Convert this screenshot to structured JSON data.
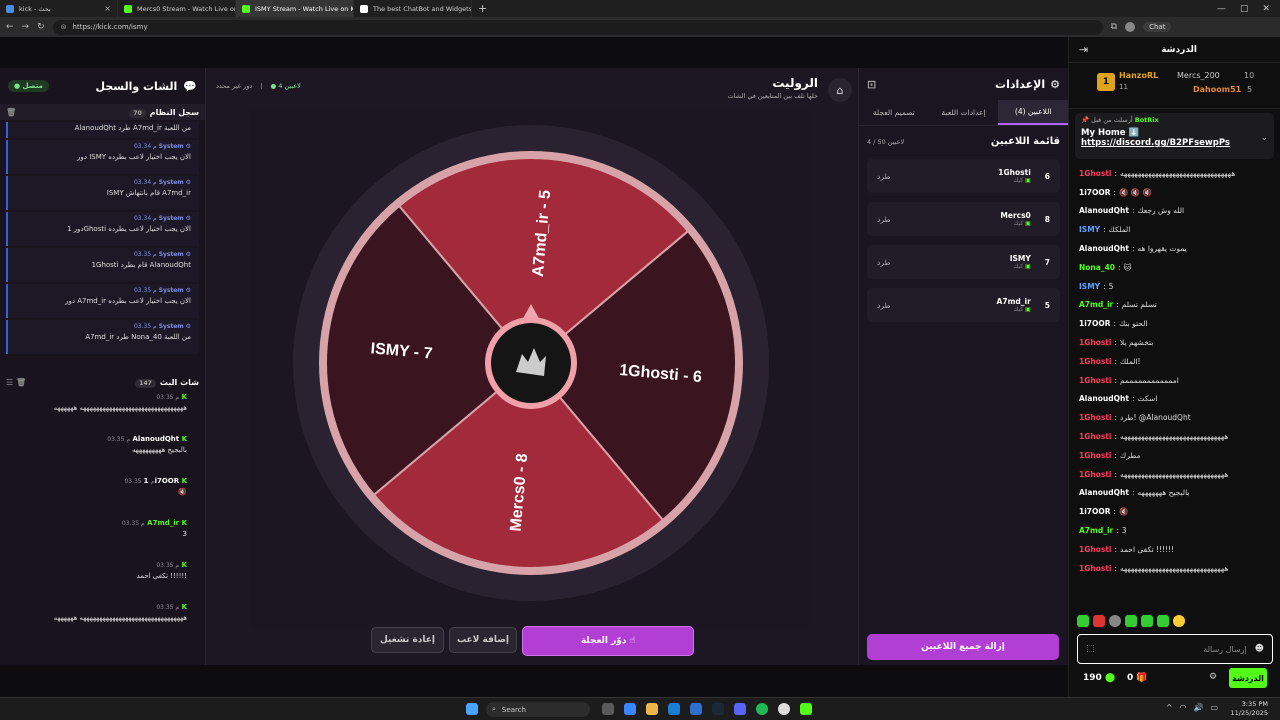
{
  "browser": {
    "tabs": [
      {
        "title": "kick - بحث",
        "color": "#4a90e2"
      },
      {
        "title": "Mercs0 Stream - Watch Live on Kick",
        "color": "#53fc18"
      },
      {
        "title": "ISMY Stream - Watch Live on Kick",
        "color": "#53fc18"
      },
      {
        "title": "The best ChatBot and Widgets fo...",
        "color": "#ffffff"
      }
    ],
    "new_tab": "+",
    "url": "https://kick.com/ismy",
    "profile": "Chat"
  },
  "left_panel": {
    "title": "الشات والسجل",
    "status": "متصل",
    "system_log": {
      "title": "سجل النظام",
      "count": "70",
      "top_text": "AlanoudQht طرد A7md_ir من اللعبة",
      "entries": [
        {
          "sender": "System",
          "time": "03.34 م",
          "text": "دور ISMY الان يجب اختيار لاعب بطرده"
        },
        {
          "sender": "System",
          "time": "03.34 م",
          "text": "ISMY قام بانتهاش A7md_ir"
        },
        {
          "sender": "System",
          "time": "03.34 م",
          "text": "دور 1Ghosti الان يجب اختيار لاعب يطرده"
        },
        {
          "sender": "System",
          "time": "03.35 م",
          "text": "1Ghosti قام بطرد AlanoudQht"
        },
        {
          "sender": "System",
          "time": "03.35 م",
          "text": "دور A7md_ir الان يجب اختيار لاعب بطرده"
        },
        {
          "sender": "System",
          "time": "03.35 م",
          "text": "A7md_ir طرد Nona_40 من اللعبة"
        }
      ]
    },
    "stream_chat": {
      "title": "شات البث",
      "count": "147",
      "messages": [
        {
          "user": "",
          "time": "03.35 م",
          "color": "#ff3b5c",
          "text": "ههههههههههههههههههههههههههههههههه ههههههه"
        },
        {
          "user": "AlanoudQht",
          "time": "03.35 م",
          "color": "#ffffff",
          "text": "بالبجيح هههههههههه"
        },
        {
          "user": "1i7OOR",
          "time": "03.35 م",
          "color": "#ffffff",
          "text": "🔇"
        },
        {
          "user": "A7md_ir",
          "time": "03.35 م",
          "color": "#53fc18",
          "text": "3"
        },
        {
          "user": "",
          "time": "03.35 م",
          "color": "#ff3b5c",
          "text": "تكفى احمد !!!!!!"
        },
        {
          "user": "",
          "time": "03.35 م",
          "color": "#ff3b5c",
          "text": "ههههههههههههههههههههههههههههههههه ههههههه"
        }
      ]
    }
  },
  "game": {
    "title": "الروليت",
    "subtitle": "خلها تلف بين المتابعين في الشات",
    "players_count": "4 لاعبين",
    "turn": "دور غير محدد",
    "segments": [
      {
        "label": "A7md_ir - 5",
        "color": "#a22a3a"
      },
      {
        "label": "1Ghosti - 6",
        "color": "#3a1520"
      },
      {
        "label": "Mercs0 - 8",
        "color": "#a22a3a"
      },
      {
        "label": "ISMY - 7",
        "color": "#3a1520"
      }
    ],
    "spin_button": "دوّر العجلة",
    "add_button": "إضافة لاعب",
    "restart_button": "إعادة تشغيل"
  },
  "settings": {
    "title": "الإعدادات",
    "tabs": [
      "اللاعبين (4)",
      "إعدادات اللعبة",
      "تصميم العجلة"
    ],
    "list_title": "قائمة اللاعبين",
    "list_count": "4 / 50 لاعبين",
    "players": [
      {
        "num": "6",
        "name": "1Ghosti",
        "tag": "كيك",
        "action": "طرد"
      },
      {
        "num": "8",
        "name": "Mercs0",
        "tag": "كيك",
        "action": "طرد"
      },
      {
        "num": "7",
        "name": "ISMY",
        "tag": "كيك",
        "action": "طرد"
      },
      {
        "num": "5",
        "name": "A7md_ir",
        "tag": "كيك",
        "action": "طرد"
      }
    ],
    "remove_all": "إزالة جميع اللاعبين"
  },
  "chat": {
    "title": "الدردشة",
    "leaders": {
      "first": "HanzoRL",
      "first_val": "11",
      "second": "Mercs_200",
      "second_val": "10",
      "third": "Dahoom51",
      "third_val": "5"
    },
    "pinned": {
      "by": "أرسلت من قبل",
      "bot": "BotRix",
      "text": "My Home ⬇️",
      "link": "https://discord.gg/B2PFsewpPs"
    },
    "lines": [
      {
        "user": "1Ghosti",
        "color": "#ff3b5c",
        "text": "ههههههههههههههههههههههههههههههههه"
      },
      {
        "user": "1i7OOR",
        "color": "#ffffff",
        "text": "🔇 🔇 🔇"
      },
      {
        "user": "AlanoudQht",
        "color": "#ffffff",
        "text": "الله وش رجعك"
      },
      {
        "user": "ISMY",
        "color": "#5aa2ff",
        "text": "الملكك"
      },
      {
        "user": "AlanoudQht",
        "color": "#ffffff",
        "text": "يموت يقهروا هه"
      },
      {
        "user": "Nona_40",
        "color": "#53fc18",
        "text": "🐱"
      },
      {
        "user": "ISMY",
        "color": "#5aa2ff",
        "text": "5"
      },
      {
        "user": "A7md_ir",
        "color": "#53fc18",
        "text": "تسلم تسلم"
      },
      {
        "user": "1i7OOR",
        "color": "#ffffff",
        "text": "الحتو بنك"
      },
      {
        "user": "1Ghosti",
        "color": "#ff3b5c",
        "text": "بتخشهم يلا"
      },
      {
        "user": "1Ghosti",
        "color": "#ff3b5c",
        "text": "الملك!"
      },
      {
        "user": "1Ghosti",
        "color": "#ff3b5c",
        "text": "اممممممممممممم"
      },
      {
        "user": "AlanoudQht",
        "color": "#ffffff",
        "text": "اسكت"
      },
      {
        "user": "1Ghosti",
        "color": "#ff3b5c",
        "text": "طرد! @AlanoudQht"
      },
      {
        "user": "1Ghosti",
        "color": "#ff3b5c",
        "text": "ههههههههههههههههههههههههههههههه"
      },
      {
        "user": "1Ghosti",
        "color": "#ff3b5c",
        "text": "مطرك"
      },
      {
        "user": "1Ghosti",
        "color": "#ff3b5c",
        "text": "ههههههههههههههههههههههههههههههه"
      },
      {
        "user": "AlanoudQht",
        "color": "#ffffff",
        "text": "بالبجيح هههههههه"
      },
      {
        "user": "1i7OOR",
        "color": "#ffffff",
        "text": "🔇"
      },
      {
        "user": "A7md_ir",
        "color": "#53fc18",
        "text": "3"
      },
      {
        "user": "1Ghosti",
        "color": "#ff3b5c",
        "text": "تكفى احمد !!!!!!"
      },
      {
        "user": "1Ghosti",
        "color": "#ff3b5c",
        "text": "ههههههههههههههههههههههههههههههه"
      }
    ],
    "input_placeholder": "إرسال رسالة",
    "send_label": "الدردشة",
    "points": "190",
    "gifts": "0"
  },
  "taskbar": {
    "search": "Search",
    "time": "3:35 PM",
    "date": "11/25/2025"
  }
}
